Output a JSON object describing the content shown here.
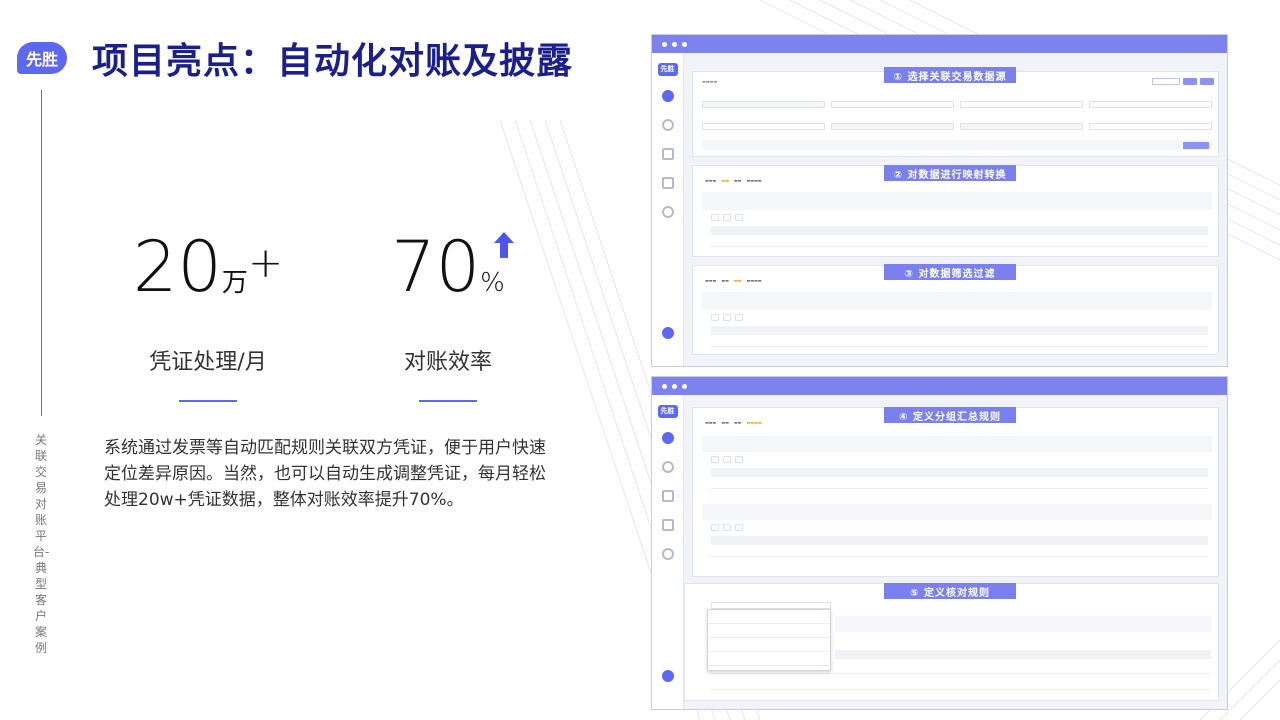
{
  "brand": {
    "badge": "先胜"
  },
  "title": "项目亮点：自动化对账及披露",
  "side_caption": "关联交易对账平台-典型客户案例",
  "stats": [
    {
      "number": "20",
      "unit": "万",
      "suffix": "+",
      "label": "凭证处理/月"
    },
    {
      "number": "70",
      "unit": "%",
      "suffix": "",
      "label": "对账效率",
      "arrow": "up-arrow-icon"
    }
  ],
  "description": "系统通过发票等自动匹配规则关联双方凭证，便于用户快速定位差异原因。当然，也可以自动生成调整凭证，每月轻松处理20w+凭证数据，整体对账效率提升70%。",
  "windows": {
    "top": {
      "logo": "先胜",
      "steps": [
        "① 选择关联交易数据源",
        "② 对数据进行映射转换",
        "③ 对数据筛选过滤"
      ]
    },
    "bottom": {
      "logo": "先胜",
      "steps": [
        "④ 定义分组汇总规则",
        "⑤ 定义核对规则"
      ]
    }
  },
  "colors": {
    "accent": "#5c68f0",
    "title": "#1b1f8a",
    "window_bar": "#7d82ef",
    "step_label": "#7b80ef"
  }
}
